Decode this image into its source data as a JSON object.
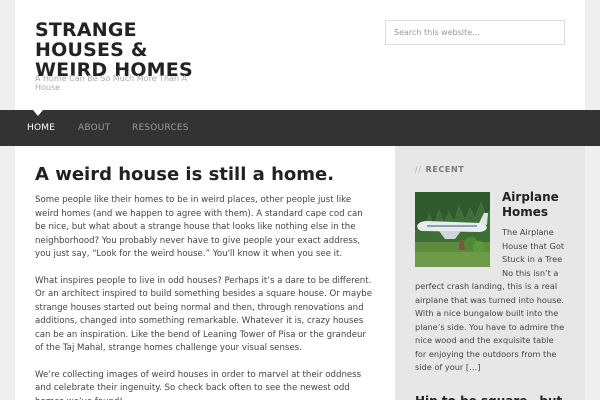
{
  "header": {
    "site_title": "STRANGE HOUSES & WEIRD HOMES",
    "tagline": "A Home Can Be So Much More Than A House",
    "search_placeholder": "Search this website…"
  },
  "nav": {
    "items": [
      "HOME",
      "ABOUT",
      "RESOURCES"
    ],
    "active": "HOME"
  },
  "article": {
    "title": "A weird house is still a home.",
    "paragraphs": [
      "Some people like their homes to be in weird places, other people just like weird homes (and we happen to agree with them). A standard cape cod can be nice, but what about a strange house that looks like nothing else in the neighborhood? You probably never have to give people your exact address, you just say, “Look for the weird house.” You'll know it when you see it.",
      "What inspires people to live in odd houses? Perhaps it’s a dare to be different. Or an architect inspired to build something besides a square house. Or maybe strange houses started out being normal and then, through renovations and additions, changed into something remarkable. Whatever it is, crazy houses can be an inspiration. Like the bend of Leaning Tower of Pisa or the grandeur of the Taj Mahal, strange homes challenge your visual senses.",
      "We’re collecting images of weird houses in order to marvel at their oddness and celebrate their ingenuity. So check back often to see the newest odd homes we’ve found!"
    ]
  },
  "sidebar": {
    "widget_slashes": "//",
    "widget_title": "RECENT",
    "posts": [
      {
        "title": "Airplane Homes",
        "excerpt": "The Airplane House that Got Stuck in a Tree No this isn’t a perfect crash landing, this is a real airplane that was turned into house. With a nice bungalow built into the plane’s side. You have to admire the nice wood and the exquisite table for enjoying the outdoors from the side of your […]"
      },
      {
        "title": "Hip to be square…but"
      }
    ]
  }
}
